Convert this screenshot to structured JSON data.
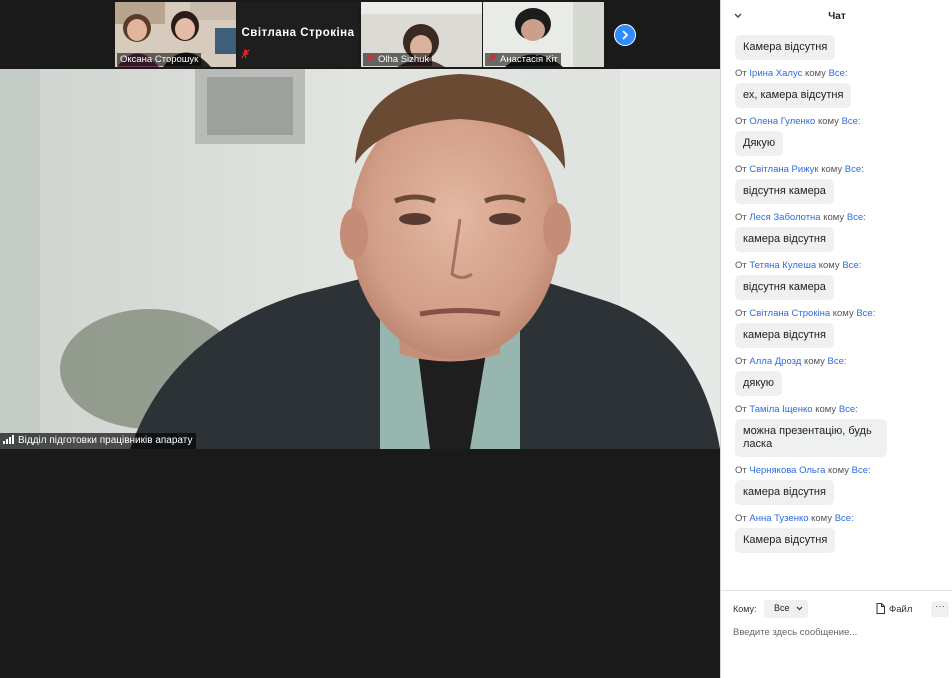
{
  "participants": [
    {
      "name": "Оксана Сторошук",
      "muted": false
    },
    {
      "name": "Світлана Строкіна",
      "muted": true,
      "video": false
    },
    {
      "name": "Olha Sizhuk",
      "muted": true
    },
    {
      "name": "Анастасія Кіт",
      "muted": true
    }
  ],
  "main_video": {
    "speaker_label": "Відділ підготовки працівників апарату"
  },
  "chat": {
    "title": "Чат",
    "from_word": "От",
    "to_word": "кому",
    "messages": [
      {
        "sender": "",
        "target": "",
        "text": "Камера відсутня"
      },
      {
        "sender": "Ірина Халус",
        "target": "Все:",
        "text": "ех, камера відсутня"
      },
      {
        "sender": "Олена Гуленко",
        "target": "Все:",
        "text": "Дякую"
      },
      {
        "sender": "Світлана Рижук",
        "target": "Все:",
        "text": "відсутня камера"
      },
      {
        "sender": "Леся Заболотна",
        "target": "Все:",
        "text": "камера відсутня"
      },
      {
        "sender": "Тетяна Кулеша",
        "target": "Все:",
        "text": "відсутня камера"
      },
      {
        "sender": "Світлана Строкіна",
        "target": "Все:",
        "text": "камера відсутня"
      },
      {
        "sender": "Алла Дрозд",
        "target": "Все:",
        "text": "дякую"
      },
      {
        "sender": "Таміла Іщенко",
        "target": "Все:",
        "text": "можна презентацію, будь ласка"
      },
      {
        "sender": "Чернякова Ольга",
        "target": "Все:",
        "text": "камера відсутня"
      },
      {
        "sender": "Анна Тузенко",
        "target": "Все:",
        "text": "Камера відсутня"
      }
    ],
    "to_label": "Кому:",
    "recipient": "Все",
    "file_label": "Файл",
    "more_label": "···",
    "input_placeholder": "Введите здесь сообщение..."
  },
  "colors": {
    "accent": "#2d8cff",
    "link": "#2d6cdf",
    "mute_red": "#e02828",
    "bubble": "#eef0f2"
  }
}
